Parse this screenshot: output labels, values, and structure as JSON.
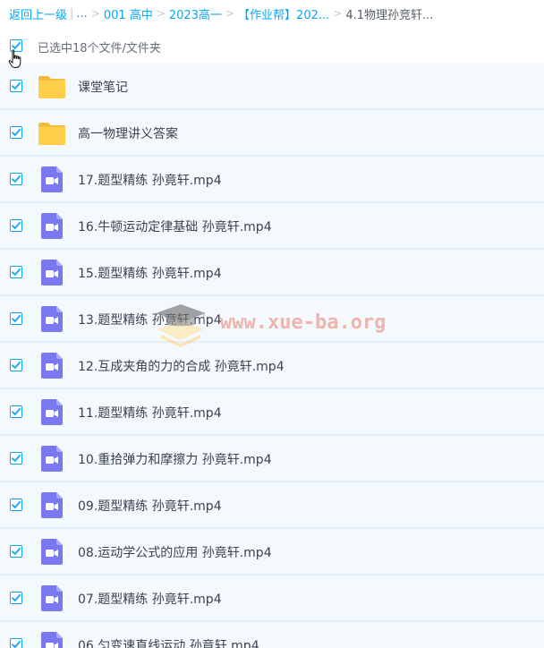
{
  "breadcrumb": {
    "back": "返回上一级",
    "pipe": "|",
    "ellipsis": "...",
    "sep": ">",
    "items": [
      "001 高中",
      "2023高一",
      "【作业帮】202..."
    ],
    "current": "4.1物理孙竞轩..."
  },
  "selection": {
    "text": "已选中18个文件/文件夹",
    "checked": true
  },
  "colors": {
    "accent": "#06a7ff",
    "folder": "#ffcf4a",
    "video": "#7a78f0",
    "row_bg": "#f4f9fe"
  },
  "files": [
    {
      "name": "课堂笔记",
      "type": "folder-icon",
      "checked": true
    },
    {
      "name": "高一物理讲义答案",
      "type": "folder-icon",
      "checked": true
    },
    {
      "name": "17.题型精练 孙竟轩.mp4",
      "type": "video-file-icon",
      "checked": true
    },
    {
      "name": "16.牛顿运动定律基础 孙竟轩.mp4",
      "type": "video-file-icon",
      "checked": true
    },
    {
      "name": "15.题型精练 孙竟轩.mp4",
      "type": "video-file-icon",
      "checked": true
    },
    {
      "name": "13.题型精练 孙竟轩.mp4",
      "type": "video-file-icon",
      "checked": true
    },
    {
      "name": "12.互成夹角的力的合成 孙竟轩.mp4",
      "type": "video-file-icon",
      "checked": true
    },
    {
      "name": "11.题型精练 孙竟轩.mp4",
      "type": "video-file-icon",
      "checked": true
    },
    {
      "name": "10.重拾弹力和摩擦力 孙竟轩.mp4",
      "type": "video-file-icon",
      "checked": true
    },
    {
      "name": "09.题型精练 孙竟轩.mp4",
      "type": "video-file-icon",
      "checked": true
    },
    {
      "name": "08.运动学公式的应用 孙竟轩.mp4",
      "type": "video-file-icon",
      "checked": true
    },
    {
      "name": "07.题型精练 孙竟轩.mp4",
      "type": "video-file-icon",
      "checked": true
    },
    {
      "name": "06.匀变速直线运动 孙竟轩.mp4",
      "type": "video-file-icon",
      "checked": true
    }
  ],
  "watermark": {
    "text": "www.xue-ba.org"
  }
}
